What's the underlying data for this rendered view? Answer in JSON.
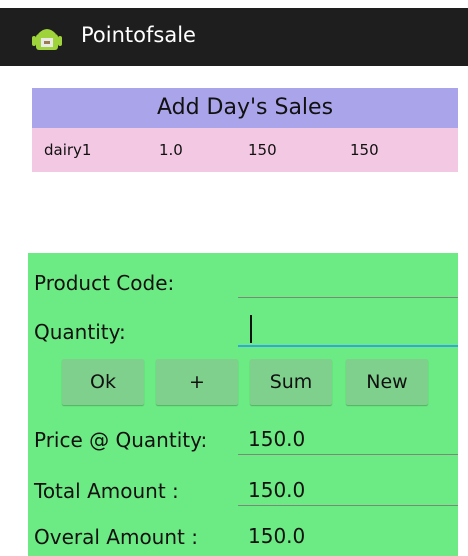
{
  "app": {
    "title": "Pointofsale",
    "icon": "android-icon"
  },
  "sales": {
    "header": "Add Day's Sales",
    "rows": [
      {
        "name": "dairy1",
        "qty": "1.0",
        "price": "150",
        "total": "150"
      }
    ]
  },
  "form": {
    "product_code_label": "Product Code:",
    "product_code_value": "",
    "quantity_label": "Quantity:",
    "quantity_value": "",
    "buttons": {
      "ok": "Ok",
      "plus": "+",
      "sum": "Sum",
      "new": "New"
    },
    "price_label": "Price @ Quantity:",
    "price_value": "150.0",
    "total_label": "Total Amount :",
    "total_value": "150.0",
    "overall_label": "Overal Amount :",
    "overall_value": "150.0"
  },
  "colors": {
    "titlebar": "#1e1e1e",
    "header_bg": "#aaa4ea",
    "row_bg": "#f3c8e3",
    "form_bg": "#6ceb84",
    "button_bg": "#7fcf8d",
    "focus_underline": "#33a7d9"
  }
}
